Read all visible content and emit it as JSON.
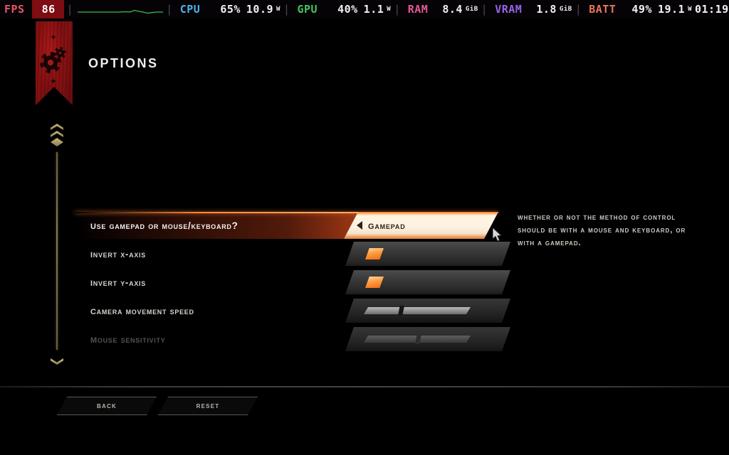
{
  "overlay": {
    "fps_label": "FPS",
    "fps_value": "86",
    "cpu_label": "CPU",
    "cpu_usage": "65%",
    "cpu_power": "10.9",
    "cpu_power_unit": "W",
    "gpu_label": "GPU",
    "gpu_usage": "40%",
    "gpu_power": "1.1",
    "gpu_power_unit": "W",
    "ram_label": "RAM",
    "ram_value": "8.4",
    "ram_unit": "GiB",
    "vram_label": "VRAM",
    "vram_value": "1.8",
    "vram_unit": "GiB",
    "batt_label": "BATT",
    "batt_percent": "49%",
    "batt_power": "19.1",
    "batt_power_unit": "W",
    "batt_time": "01:19",
    "separator": "|",
    "graph_color": "#3fbd4a",
    "fps_box_color": "#7d0d13"
  },
  "header": {
    "title": "OPTIONS",
    "banner_color": "#a8181a"
  },
  "scrollbar": {
    "up_icon": "double-chevron-up",
    "down_icon": "double-chevron-down",
    "accent_color": "#cbb97f"
  },
  "options": {
    "rows": [
      {
        "label": "Use Gamepad or Mouse/Keyboard?",
        "type": "selector",
        "value": "Gamepad",
        "selected": true,
        "enabled": true
      },
      {
        "label": "Invert X-axis",
        "type": "toggle",
        "value": "off",
        "selected": false,
        "enabled": true
      },
      {
        "label": "Invert Y-axis",
        "type": "toggle",
        "value": "off",
        "selected": false,
        "enabled": true
      },
      {
        "label": "Camera movement speed",
        "type": "slider",
        "value": "35",
        "selected": false,
        "enabled": true
      },
      {
        "label": "Mouse Sensitivity",
        "type": "slider",
        "value": "48",
        "selected": false,
        "enabled": false
      }
    ]
  },
  "description": {
    "text": "Whether or not the method of control should be with a mouse and keyboard, or with a gamepad."
  },
  "footer": {
    "back_label": "Back",
    "reset_label": "Reset"
  },
  "theme": {
    "highlight_orange": "#ff7a24",
    "chip_cream": "#fdf3e2",
    "text_primary": "#d8d4cd",
    "text_disabled": "#55534f"
  }
}
